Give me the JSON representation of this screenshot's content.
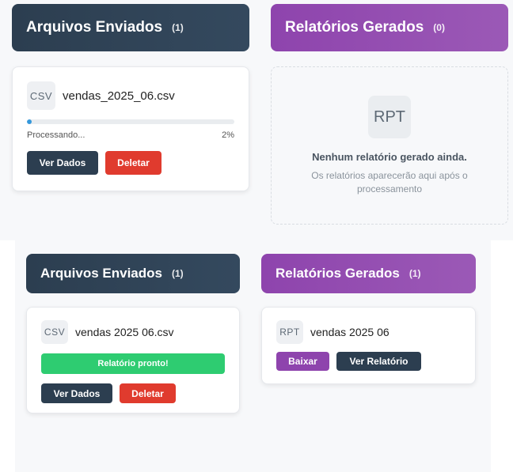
{
  "state_before": {
    "files_panel": {
      "title": "Arquivos Enviados",
      "count": "(1)"
    },
    "reports_panel": {
      "title": "Relatórios Gerados",
      "count": "(0)"
    },
    "file_card": {
      "icon": "CSV",
      "filename": "vendas_2025_06.csv",
      "progress_label": "Processando...",
      "progress_percent_text": "2%",
      "progress_value": 0.02,
      "view_button": "Ver Dados",
      "delete_button": "Deletar"
    },
    "empty_reports": {
      "icon": "RPT",
      "title": "Nenhum relatório gerado ainda.",
      "subtitle": "Os relatórios aparecerão aqui após o processamento"
    }
  },
  "state_after": {
    "files_panel": {
      "title": "Arquivos Enviados",
      "count": "(1)"
    },
    "reports_panel": {
      "title": "Relatórios Gerados",
      "count": "(1)"
    },
    "file_card": {
      "icon": "CSV",
      "filename": "vendas 2025 06.csv",
      "ready_label": "Relatório pronto!",
      "view_button": "Ver Dados",
      "delete_button": "Deletar"
    },
    "report_card": {
      "icon": "RPT",
      "name": "vendas 2025 06",
      "download_button": "Baixar",
      "view_report_button": "Ver Relatório"
    }
  },
  "colors": {
    "files_header": "#2c3e50",
    "reports_header": "#8e44ad",
    "progress": "#3498db",
    "success": "#2ecc71",
    "danger": "#e03b2e"
  }
}
